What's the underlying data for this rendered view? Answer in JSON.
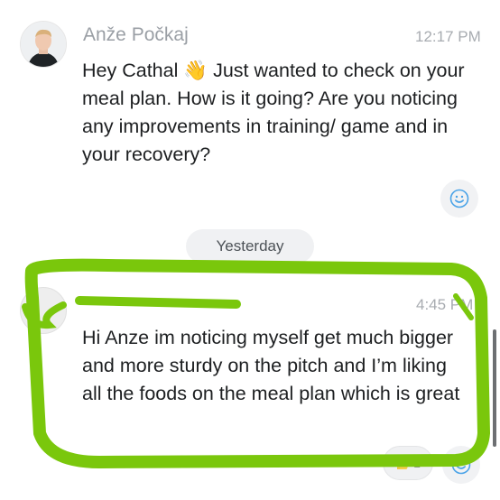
{
  "message1": {
    "sender": "Anže Počkaj",
    "time": "12:17 PM",
    "text_before_emoji": "Hey Cathal ",
    "emoji": "👋",
    "text_after_emoji": " Just wanted to check on your meal plan. How is it going? Are you noticing any improvements in training/ game and in your recovery?"
  },
  "date_divider": "Yesterday",
  "message2": {
    "sender": "",
    "time": "4:45 PM",
    "text": "Hi Anze im noticing myself get much bigger and more sturdy on the pitch and I’m liking all the foods on the meal plan which is great",
    "reaction_count": "1"
  },
  "icons": {
    "reaction_add": "smiley-icon",
    "thumbs_up": "thumbs-up-icon"
  },
  "colors": {
    "highlight": "#7ac70c",
    "smiley": "#4aa3e8"
  }
}
